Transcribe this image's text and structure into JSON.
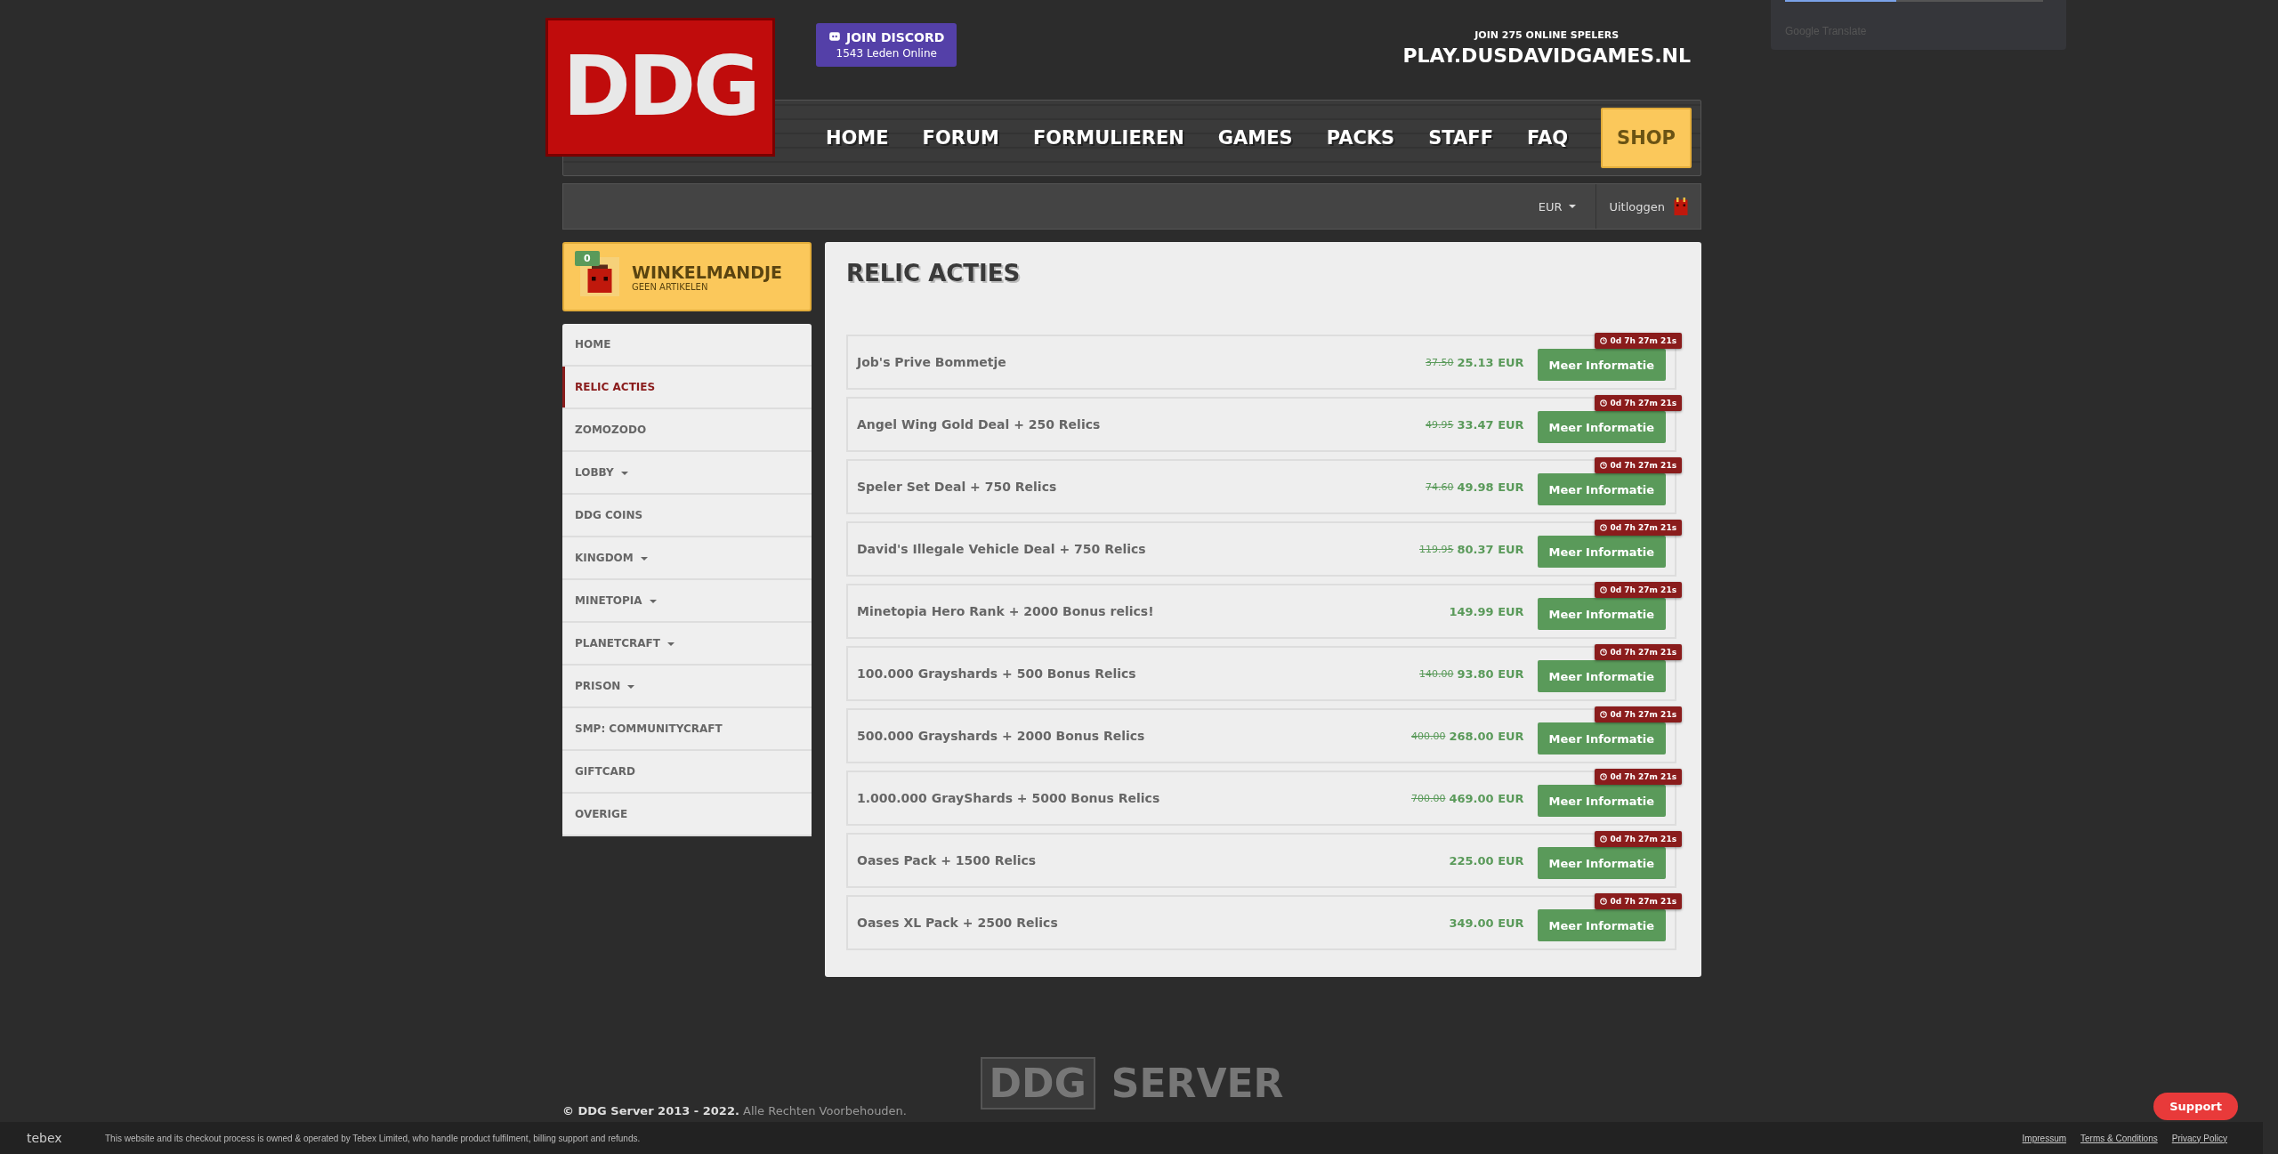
{
  "header": {
    "logo": "DDG",
    "discord": {
      "title": "JOIN DISCORD",
      "members": "1543 Leden Online"
    },
    "server": {
      "join": "JOIN 275 ONLINE SPELERS",
      "address": "PLAY.DUSDAVIDGAMES.NL"
    }
  },
  "nav": [
    {
      "label": "HOME",
      "kind": "link"
    },
    {
      "label": "FORUM",
      "kind": "link"
    },
    {
      "label": "FORMULIEREN",
      "kind": "link"
    },
    {
      "label": "GAMES",
      "kind": "link"
    },
    {
      "label": "PACKS",
      "kind": "link"
    },
    {
      "label": "STAFF",
      "kind": "link"
    },
    {
      "label": "FAQ",
      "kind": "link"
    },
    {
      "label": "SHOP",
      "kind": "highlight"
    }
  ],
  "account_bar": {
    "currency": "EUR",
    "logout": "Uitloggen"
  },
  "cart": {
    "count": "0",
    "title": "WINKELMANDJE",
    "subtitle": "GEEN ARTIKELEN"
  },
  "sidebar": {
    "items": [
      {
        "label": "HOME",
        "selected": false,
        "dropdown": false
      },
      {
        "label": "RELIC ACTIES",
        "selected": true,
        "dropdown": false
      },
      {
        "label": "ZOMOZODO",
        "selected": false,
        "dropdown": false
      },
      {
        "label": "LOBBY",
        "selected": false,
        "dropdown": true
      },
      {
        "label": "DDG COINS",
        "selected": false,
        "dropdown": false
      },
      {
        "label": "KINGDOM",
        "selected": false,
        "dropdown": true
      },
      {
        "label": "MINETOPIA",
        "selected": false,
        "dropdown": true
      },
      {
        "label": "PLANETCRAFT",
        "selected": false,
        "dropdown": true
      },
      {
        "label": "PRISON",
        "selected": false,
        "dropdown": true
      },
      {
        "label": "SMP: COMMUNITYCRAFT",
        "selected": false,
        "dropdown": false
      },
      {
        "label": "GIFTCARD",
        "selected": false,
        "dropdown": false
      },
      {
        "label": "OVERIGE",
        "selected": false,
        "dropdown": false
      }
    ]
  },
  "main": {
    "title": "RELIC ACTIES",
    "products": [
      {
        "name": "Job's Prive Bommetje",
        "old_price": "37.50",
        "price": "25.13 EUR",
        "timer": "0d 7h 27m 21s",
        "button": "Meer Informatie"
      },
      {
        "name": "Angel Wing Gold Deal + 250 Relics",
        "old_price": "49.95",
        "price": "33.47 EUR",
        "timer": "0d 7h 27m 21s",
        "button": "Meer Informatie"
      },
      {
        "name": "Speler Set Deal + 750 Relics",
        "old_price": "74.60",
        "price": "49.98 EUR",
        "timer": "0d 7h 27m 21s",
        "button": "Meer Informatie"
      },
      {
        "name": "David's Illegale Vehicle Deal + 750 Relics",
        "old_price": "119.95",
        "price": "80.37 EUR",
        "timer": "0d 7h 27m 21s",
        "button": "Meer Informatie"
      },
      {
        "name": "Minetopia Hero Rank + 2000 Bonus relics!",
        "price": "149.99 EUR",
        "timer": "0d 7h 27m 21s",
        "button": "Meer Informatie"
      },
      {
        "name": "100.000 Grayshards + 500 Bonus Relics",
        "old_price": "140.00",
        "price": "93.80 EUR",
        "timer": "0d 7h 27m 21s",
        "button": "Meer Informatie"
      },
      {
        "name": "500.000 Grayshards + 2000 Bonus Relics",
        "old_price": "400.00",
        "price": "268.00 EUR",
        "timer": "0d 7h 27m 21s",
        "button": "Meer Informatie"
      },
      {
        "name": "1.000.000 GrayShards + 5000 Bonus Relics",
        "old_price": "700.00",
        "price": "469.00 EUR",
        "timer": "0d 7h 27m 21s",
        "button": "Meer Informatie"
      },
      {
        "name": "Oases Pack + 1500 Relics",
        "price": "225.00 EUR",
        "timer": "0d 7h 27m 21s",
        "button": "Meer Informatie"
      },
      {
        "name": "Oases XL Pack + 2500 Relics",
        "price": "349.00 EUR",
        "timer": "0d 7h 27m 21s",
        "button": "Meer Informatie"
      }
    ]
  },
  "footer": {
    "logo_left": "DDG",
    "logo_right": "SERVER",
    "copyright": "**© DDG Server 2013 - 2022.** Alle Rechten Voorbehouden."
  },
  "tebex_bar": {
    "brand": "tebex",
    "notice": "This website and its checkout process is owned & operated by Tebex Limited, who handle product fulfilment, billing support and refunds.",
    "links": [
      "Impressum",
      "Terms & Conditions",
      "Privacy Policy"
    ]
  },
  "support_button": "Support",
  "translate_popup": {
    "level": 0.43,
    "label": "Google Translate"
  }
}
